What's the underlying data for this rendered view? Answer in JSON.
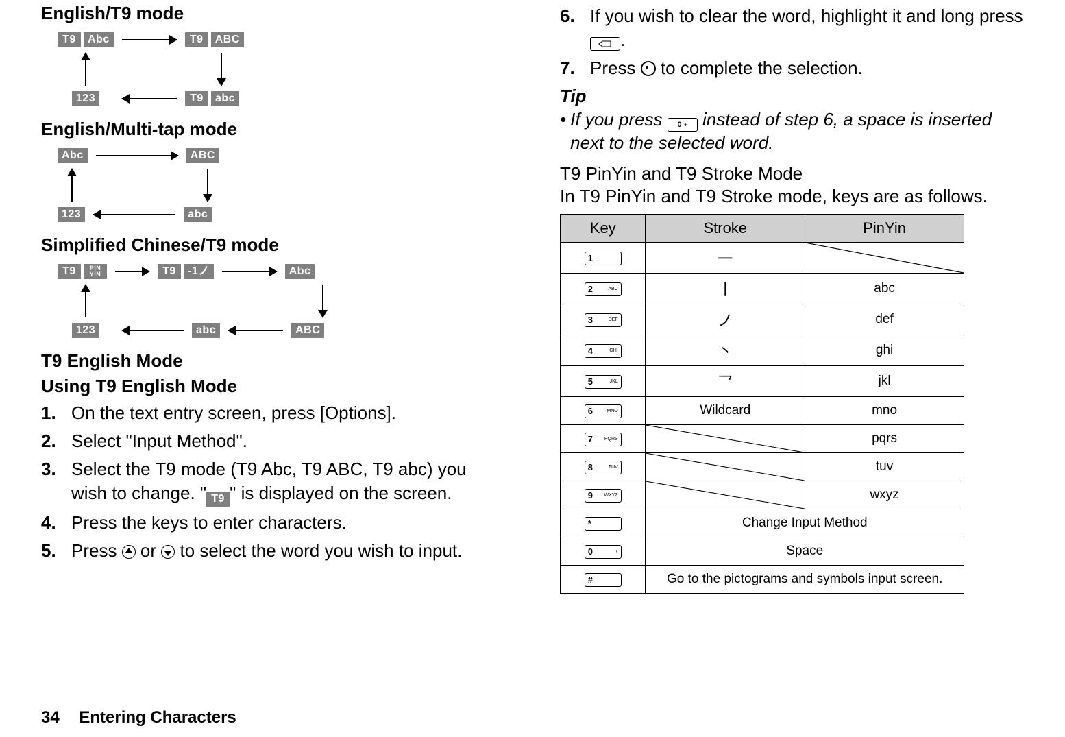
{
  "left": {
    "h_english_t9": "English/T9 mode",
    "h_english_multi": "English/Multi-tap mode",
    "h_simp_chinese": "Simplified Chinese/T9 mode",
    "h_t9_english": "T9 English Mode",
    "h_using_t9": "Using T9 English Mode",
    "badges": {
      "t9": "T9",
      "abc_title": "Abc",
      "abc_upper": "ABC",
      "abc_lower": "abc",
      "num": "123",
      "pinyin": "PIN YIN",
      "stroke": "-1ノ"
    },
    "steps": [
      {
        "n": "1.",
        "t": "On the text entry screen, press [Options]."
      },
      {
        "n": "2.",
        "t": "Select \"Input Method\"."
      },
      {
        "n": "3.",
        "t": "Select the T9 mode (T9 Abc, T9 ABC, T9 abc) you wish to change. \" T9 \" is displayed on the screen."
      },
      {
        "n": "4.",
        "t": "Press the keys to enter characters."
      },
      {
        "n": "5.",
        "t": "Press  ▲  or  ▼  to select the word you wish to input."
      }
    ]
  },
  "right": {
    "steps": [
      {
        "n": "6.",
        "t": "If you wish to clear the word, highlight it and long press  ⌫ ."
      },
      {
        "n": "7.",
        "t": "Press  ◎  to complete the selection."
      }
    ],
    "tip_head": "Tip",
    "tip_body": "If you press  0  instead of step 6, a space is inserted next to the selected word.",
    "mode_head": "T9 PinYin and T9 Stroke Mode",
    "mode_desc": "In T9 PinYin and T9 Stroke mode, keys are as follows.",
    "table": {
      "headers": [
        "Key",
        "Stroke",
        "PinYin"
      ],
      "rows": [
        {
          "key_main": "1",
          "key_sub": "",
          "stroke": "一",
          "pinyin": "__DIAG__"
        },
        {
          "key_main": "2",
          "key_sub": "ABC",
          "stroke": "丨",
          "pinyin": "abc"
        },
        {
          "key_main": "3",
          "key_sub": "DEF",
          "stroke": "ノ",
          "pinyin": "def"
        },
        {
          "key_main": "4",
          "key_sub": "GHI",
          "stroke": "丶",
          "pinyin": "ghi"
        },
        {
          "key_main": "5",
          "key_sub": "JKL",
          "stroke": "乛",
          "pinyin": "jkl"
        },
        {
          "key_main": "6",
          "key_sub": "MNO",
          "stroke": "Wildcard",
          "pinyin": "mno"
        },
        {
          "key_main": "7",
          "key_sub": "PQRS",
          "stroke": "__DIAG__",
          "pinyin": "pqrs"
        },
        {
          "key_main": "8",
          "key_sub": "TUV",
          "stroke": "__DIAG__",
          "pinyin": "tuv"
        },
        {
          "key_main": "9",
          "key_sub": "WXYZ",
          "stroke": "__DIAG__",
          "pinyin": "wxyz"
        },
        {
          "key_main": "*",
          "key_sub": "",
          "merged": "Change Input Method"
        },
        {
          "key_main": "0",
          "key_sub": "+",
          "merged": "Space"
        },
        {
          "key_main": "#",
          "key_sub": "",
          "merged": "Go to the pictograms and symbols input screen."
        }
      ]
    }
  },
  "footer": {
    "page": "34",
    "title": "Entering Characters"
  }
}
